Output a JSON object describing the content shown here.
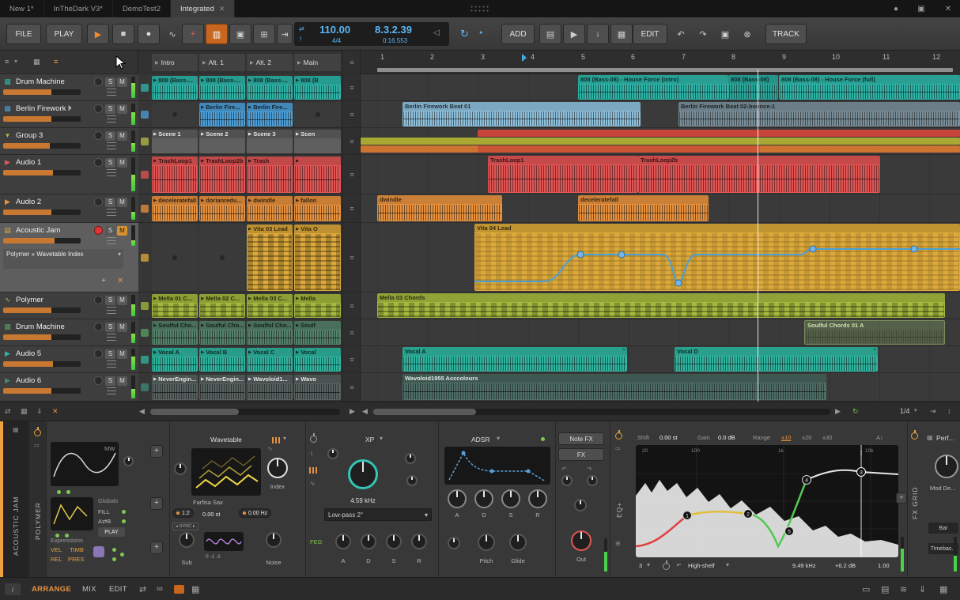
{
  "g": {
    "play": "▶",
    "stop": "■",
    "record": "●",
    "automation": "∿",
    "punch": "+",
    "metronome": "▥",
    "follow": "▣",
    "fit": "⊞",
    "export": "⇥",
    "speaker": "◁",
    "loop": "↻",
    "chevron": "▾",
    "close": "✕",
    "menu": "≡",
    "undo": "↶",
    "redo": "↷",
    "duplicate": "▣",
    "delete": "⊗",
    "piano": "▤",
    "down": "↓",
    "grid": "▦",
    "left": "◀",
    "right": "▶",
    "plus": "+",
    "x": "✕",
    "updown": "↕",
    "wave": "∿",
    "shuffle": "⇄",
    "link": "∞",
    "download": "⇓",
    "doc": "▤",
    "monitor": "▭",
    "stack": "≋",
    "shelf": "⌐",
    "autoscale": "A↕",
    "info": "i",
    "dot": "●",
    "fade": "≈",
    "sync_l": "◂",
    "sync_r": "▸"
  },
  "window": {
    "tabs": [
      "New 1*",
      "InTheDark V3*",
      "DemoTest2",
      "Integrated"
    ]
  },
  "toolbar": {
    "file": "FILE",
    "play": "PLAY",
    "add": "ADD",
    "edit": "EDIT",
    "track": "TRACK",
    "tempo": "110.00",
    "timesig": "4/4",
    "position": "8.3.2.39",
    "time": "0:16.553"
  },
  "labels": {
    "solo": "S",
    "mute": "M"
  },
  "tracks": [
    {
      "name": "Drum Machine"
    },
    {
      "name": "Berlin Firework Kit"
    },
    {
      "name": "Group 3"
    },
    {
      "name": "Audio 1"
    },
    {
      "name": "Audio 2"
    },
    {
      "name": "Acoustic Jam",
      "device_chain": "Polymer » Wavetable Index"
    },
    {
      "name": "Polymer"
    },
    {
      "name": "Drum Machine"
    },
    {
      "name": "Audio 5"
    },
    {
      "name": "Audio 6"
    }
  ],
  "scenes": [
    "Intro",
    "Alt. 1",
    "Alt. 2",
    "Main"
  ],
  "launcher": [
    [
      "808 (Bass-...",
      "808 (Bass-...",
      "808 (Bass-...",
      "808 (B"
    ],
    [
      "",
      "Berlin Fire...",
      "Berlin Fire...",
      ""
    ],
    [
      "Scene 1",
      "Scene 2",
      "Scene 3",
      "Scen"
    ],
    [
      "TrashLoop1",
      "TrashLoop2b",
      "Trash",
      ""
    ],
    [
      "deceleratefall",
      "dorianredu...",
      "dwindle",
      "fallon"
    ],
    [
      "",
      "",
      "Vita 03 Lead",
      "Vita O"
    ],
    [
      "Mella 01 C...",
      "Mella 02 C...",
      "Mella 03 C...",
      "Mella"
    ],
    [
      "Soulful Cho...",
      "Soulful Cho...",
      "Soulful Cho...",
      "Soulf"
    ],
    [
      "Vocal A",
      "Vocal B",
      "Vocal C",
      "Vocal"
    ],
    [
      "NeverEngin...",
      "NeverEngin...",
      "Wavoloid1...",
      "Wavo"
    ]
  ],
  "ruler": {
    "bars": [
      "1",
      "2",
      "3",
      "4",
      "5",
      "6",
      "7",
      "8",
      "9",
      "10",
      "11",
      "12"
    ]
  },
  "arranger": {
    "drum1": [
      "808 (Bass-08) - House Force (intro)",
      "808 (Bass-08)",
      "808 (Bass-08) - House Force (full)"
    ],
    "berlin": [
      "Berlin Firework Beat 01",
      "Berlin Firework Beat 02-bounce-1"
    ],
    "audio1": [
      "TrashLoop1",
      "TrashLoop2b"
    ],
    "audio2": [
      "dwindle",
      "deceleratefall"
    ],
    "jam": [
      "Vita 04 Lead"
    ],
    "polymer": [
      "Mella 03 Chords"
    ],
    "drum2": [
      "Soulful Chords 01 A"
    ],
    "audio5": [
      "Vocal A",
      "Vocal D"
    ],
    "audio6": [
      "Wavoloid1955 Acccolours"
    ]
  },
  "view": {
    "snap": "1/4"
  },
  "device": {
    "track": "ACOUSTIC JAM",
    "polymer": {
      "name": "POLYMER",
      "mw": "MW",
      "globals": "Globals",
      "fill": "FILL",
      "ab": "A⇄B",
      "playmode": "PLAY",
      "expressions": "Expressions",
      "vel": "VEL",
      "timb": "TIMB",
      "rel": "REL",
      "pres": "PRES",
      "wt_title": "Wavetable",
      "wt_name": "Farfisa Sax",
      "index": "Index",
      "ratio": "1:2",
      "st": "0.00 st",
      "hz": "0.00 Hz",
      "sync": "SYNC",
      "sub": "Sub",
      "sub_vals": "0  -1  -2",
      "noise": "Noise",
      "xp": "XP",
      "cutoff": "4.59 kHz",
      "filter_mode": "Low-pass 2°",
      "feg": "FEG",
      "a": "A",
      "d": "D",
      "s": "S",
      "r": "R",
      "adsr": "ADSR",
      "note_fx": "Note FX",
      "fx": "FX",
      "pitch": "Pitch",
      "glide": "Glide",
      "out": "Out"
    },
    "eq": {
      "name": "EQ+",
      "shift_label": "Shift",
      "shift": "0.00 st",
      "gain_label": "Gain",
      "gain": "0.0 dB",
      "range_label": "Range",
      "r1": "±10",
      "r2": "±20",
      "r3": "±30",
      "f1": "20",
      "f2": "100",
      "f3": "1k",
      "f4": "10k",
      "band": "3",
      "type": "High-shelf",
      "freq": "9.49 kHz",
      "bgain": "+6.2 dB",
      "q": "1.00",
      "n1": "1",
      "n2": "2",
      "n3": "3",
      "n4": "4",
      "n5": "5"
    },
    "fxgrid": {
      "name": "FX GRID",
      "perf": "Perf...",
      "mod": "Mod De...",
      "bar": "Bar",
      "timebase": "Timebas..."
    }
  },
  "statusbar": {
    "arrange": "ARRANGE",
    "mix": "MIX",
    "edit": "EDIT"
  }
}
